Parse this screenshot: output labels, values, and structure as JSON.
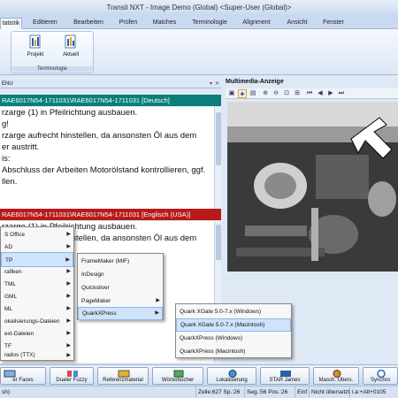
{
  "window": {
    "title": "Transit NXT - Image Demo (Global) <Super-User (Global)>"
  },
  "menu": {
    "tabs": [
      "tatistik",
      "Editieren",
      "Bearbeiten",
      "Prüfen",
      "Matches",
      "Terminologie",
      "Alignment",
      "Ansicht",
      "Fenster"
    ],
    "active_index": 0
  },
  "ribbon": {
    "group_label": "Terminologie",
    "buttons": [
      {
        "label": "Projekt",
        "icon": "term-project-icon"
      },
      {
        "label": "Aktuell",
        "icon": "term-current-icon"
      }
    ]
  },
  "left_panel": {
    "header": "ENU"
  },
  "source": {
    "segment_bar": "RAE6017N54-1711031\\RAE6017N54-1711031 [Deutsch]",
    "lines": [
      "rzarge (1) in Pfeilrichtung ausbauen.",
      "g!",
      "rzarge aufrecht hinstellen, da ansonsten Öl aus dem",
      "er austritt.",
      "is:",
      "Abschluss der Arbeiten Motorölstand kontrollieren, ggf.",
      "llen."
    ]
  },
  "target": {
    "segment_bar": "RAE6017N54-1711031\\RAE6017N54-1711031 [Englisch (USA)]",
    "lines": [
      "rzarge (1) in Pfeilrichtung ausbauen.",
      "",
      "rzarge aufrecht hinstellen, da ansonsten Öl aus dem"
    ]
  },
  "multimedia": {
    "title": "Multimedia-Anzeige"
  },
  "context_menu_1": {
    "items": [
      "S Office",
      "AD",
      "TP",
      "rafiken",
      "TML",
      "GML",
      "ML",
      "okalisierungs-Dateien",
      "ext-Dateien",
      "TF",
      "rados (TTX)"
    ],
    "highlighted_index": 2
  },
  "context_menu_2": {
    "items": [
      "FrameMaker (MIF)",
      "InDesign",
      "Quicksilver",
      "PageMaker",
      "QuarkXPress"
    ],
    "submenu_indices": [
      3,
      4
    ],
    "highlighted_index": 4
  },
  "context_menu_3": {
    "items": [
      "Quark XGate 5.0-7.x (Windows)",
      "Quark XGate 5.0-7.x (Macintosh)",
      "QuarkXPress (Windows)",
      "QuarkXPress (Macintosh)"
    ],
    "highlighted_index": 1
  },
  "taskbar": {
    "buttons": [
      "er Faces",
      "Dualer Fuzzy",
      "Referenzmaterial",
      "Wörterbücher",
      "Lokalisierung",
      "STAR James",
      "Masch. Übers.",
      "Synchro"
    ]
  },
  "status_bar": {
    "cells": [
      "sh)",
      "Zeile:627 Sp.:26",
      "Seg.:56 Pos.:26",
      "Einf",
      "Nicht übersetzt",
      "i.a:+Alt+0105"
    ]
  },
  "colors": {
    "source_bar": "#0a7f7a",
    "target_bar": "#b71a1a",
    "highlight": "#cfe3fb",
    "ribbon_bg": "#dbe6f5"
  }
}
